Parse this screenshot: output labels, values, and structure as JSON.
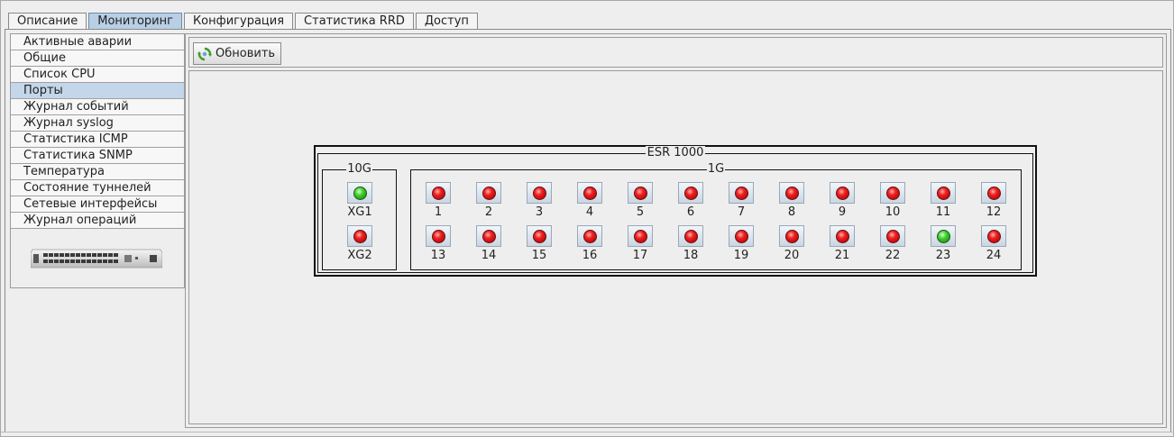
{
  "top_tabs": [
    {
      "label": "Описание",
      "active": false
    },
    {
      "label": "Мониторинг",
      "active": true
    },
    {
      "label": "Конфигурация",
      "active": false
    },
    {
      "label": "Статистика RRD",
      "active": false
    },
    {
      "label": "Доступ",
      "active": false
    }
  ],
  "sidebar": {
    "items": [
      {
        "label": "Активные аварии",
        "active": false
      },
      {
        "label": "Общие",
        "active": false
      },
      {
        "label": "Список CPU",
        "active": false
      },
      {
        "label": "Порты",
        "active": true
      },
      {
        "label": "Журнал событий",
        "active": false
      },
      {
        "label": "Журнал syslog",
        "active": false
      },
      {
        "label": "Статистика ICMP",
        "active": false
      },
      {
        "label": "Статистика SNMP",
        "active": false
      },
      {
        "label": "Температура",
        "active": false
      },
      {
        "label": "Состояние туннелей",
        "active": false
      },
      {
        "label": "Сетевые интерфейсы",
        "active": false
      },
      {
        "label": "Журнал операций",
        "active": false
      }
    ]
  },
  "toolbar": {
    "refresh_label": "Обновить"
  },
  "device": {
    "title": "ESR 1000",
    "group_10g": {
      "label": "10G",
      "ports": [
        {
          "label": "XG1",
          "status": "green"
        },
        {
          "label": "XG2",
          "status": "red"
        }
      ]
    },
    "group_1g": {
      "label": "1G",
      "ports": [
        {
          "label": "1",
          "status": "red"
        },
        {
          "label": "2",
          "status": "red"
        },
        {
          "label": "3",
          "status": "red"
        },
        {
          "label": "4",
          "status": "red"
        },
        {
          "label": "5",
          "status": "red"
        },
        {
          "label": "6",
          "status": "red"
        },
        {
          "label": "7",
          "status": "red"
        },
        {
          "label": "8",
          "status": "red"
        },
        {
          "label": "9",
          "status": "red"
        },
        {
          "label": "10",
          "status": "red"
        },
        {
          "label": "11",
          "status": "red"
        },
        {
          "label": "12",
          "status": "red"
        },
        {
          "label": "13",
          "status": "red"
        },
        {
          "label": "14",
          "status": "red"
        },
        {
          "label": "15",
          "status": "red"
        },
        {
          "label": "16",
          "status": "red"
        },
        {
          "label": "17",
          "status": "red"
        },
        {
          "label": "18",
          "status": "red"
        },
        {
          "label": "19",
          "status": "red"
        },
        {
          "label": "20",
          "status": "red"
        },
        {
          "label": "21",
          "status": "red"
        },
        {
          "label": "22",
          "status": "red"
        },
        {
          "label": "23",
          "status": "green"
        },
        {
          "label": "24",
          "status": "red"
        }
      ]
    }
  },
  "colors": {
    "active_tab": "#b8cfe5",
    "active_sidebar": "#c3d6ea",
    "led_red": "#ee2020",
    "led_green": "#3ecf2e"
  },
  "icons": {
    "refresh": "refresh-icon",
    "device_image": "switch-device-icon"
  }
}
